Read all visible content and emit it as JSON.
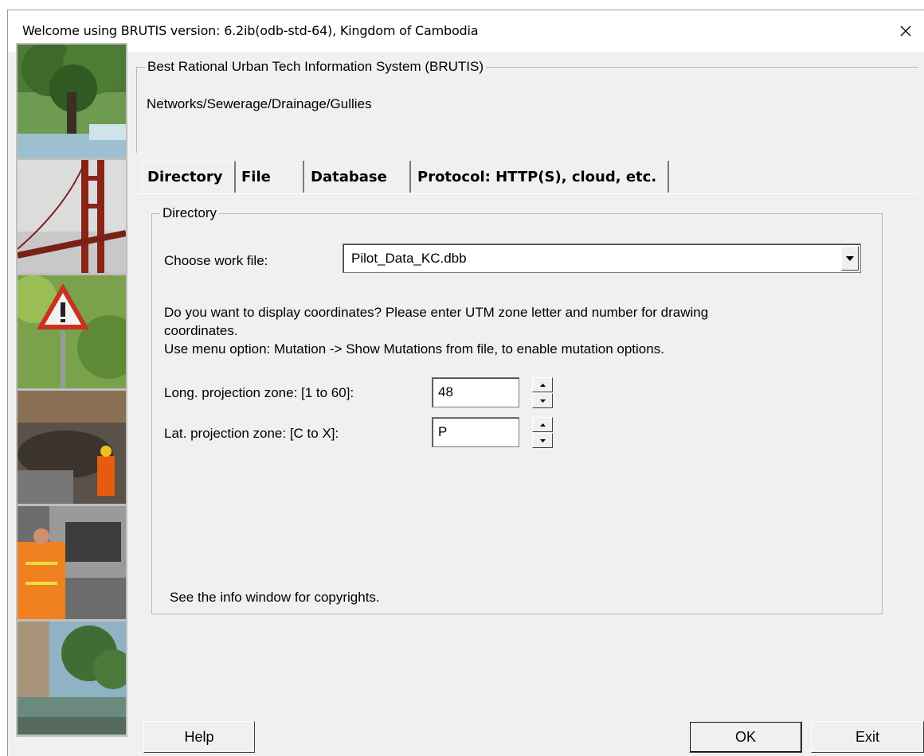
{
  "window": {
    "title": "Welcome using BRUTIS version: 6.2ib(odb-std-64), Kingdom of Cambodia",
    "close_icon": "close-icon"
  },
  "header": {
    "group_title": "Best Rational Urban Tech Information System (BRUTIS)",
    "subtitle": "Networks/Sewerage/Drainage/Gullies"
  },
  "tabs": [
    {
      "label": "Directory",
      "active": true
    },
    {
      "label": "File",
      "active": false
    },
    {
      "label": "Database",
      "active": false
    },
    {
      "label": "Protocol: HTTP(S), cloud, etc.",
      "active": false
    }
  ],
  "directory": {
    "group_title": "Directory",
    "work_file_label": "Choose work file:",
    "work_file_value": "Pilot_Data_KC.dbb",
    "coord_prompt_line1": "Do you want to display coordinates?  Please enter UTM zone letter and number for drawing",
    "coord_prompt_line2": "coordinates.",
    "mutation_hint": "Use menu option: Mutation -> Show Mutations from file, to enable mutation options.",
    "long_zone_label": "Long. projection zone: [1 to 60]:",
    "long_zone_value": "48",
    "lat_zone_label": "Lat. projection zone: [C to X]:",
    "lat_zone_value": "P",
    "copyright_note": "See the info window for copyrights."
  },
  "buttons": {
    "help": "Help",
    "ok": "OK",
    "exit": "Exit"
  },
  "colors": {
    "dialog_bg": "#f0f0f0",
    "border": "#b9b9b9"
  }
}
